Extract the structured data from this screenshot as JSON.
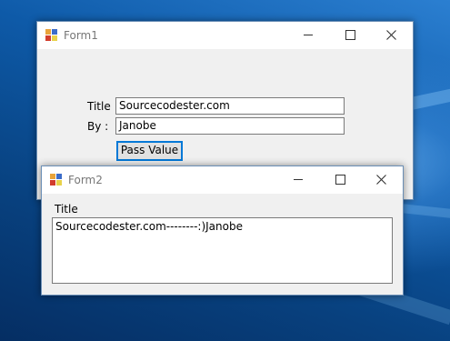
{
  "desktop": {
    "accent": "#0a4f8c"
  },
  "form1": {
    "title": "Form1",
    "title_label": "Title",
    "title_value": "Sourcecodester.com",
    "by_label": "By :",
    "by_value": "Janobe",
    "pass_button": "Pass Value"
  },
  "form2": {
    "title": "Form2",
    "title_label": "Title",
    "text_value": "Sourcecodester.com--------:)Janobe"
  },
  "icons": [
    "app-icon",
    "minimize-icon",
    "maximize-icon",
    "close-icon"
  ]
}
